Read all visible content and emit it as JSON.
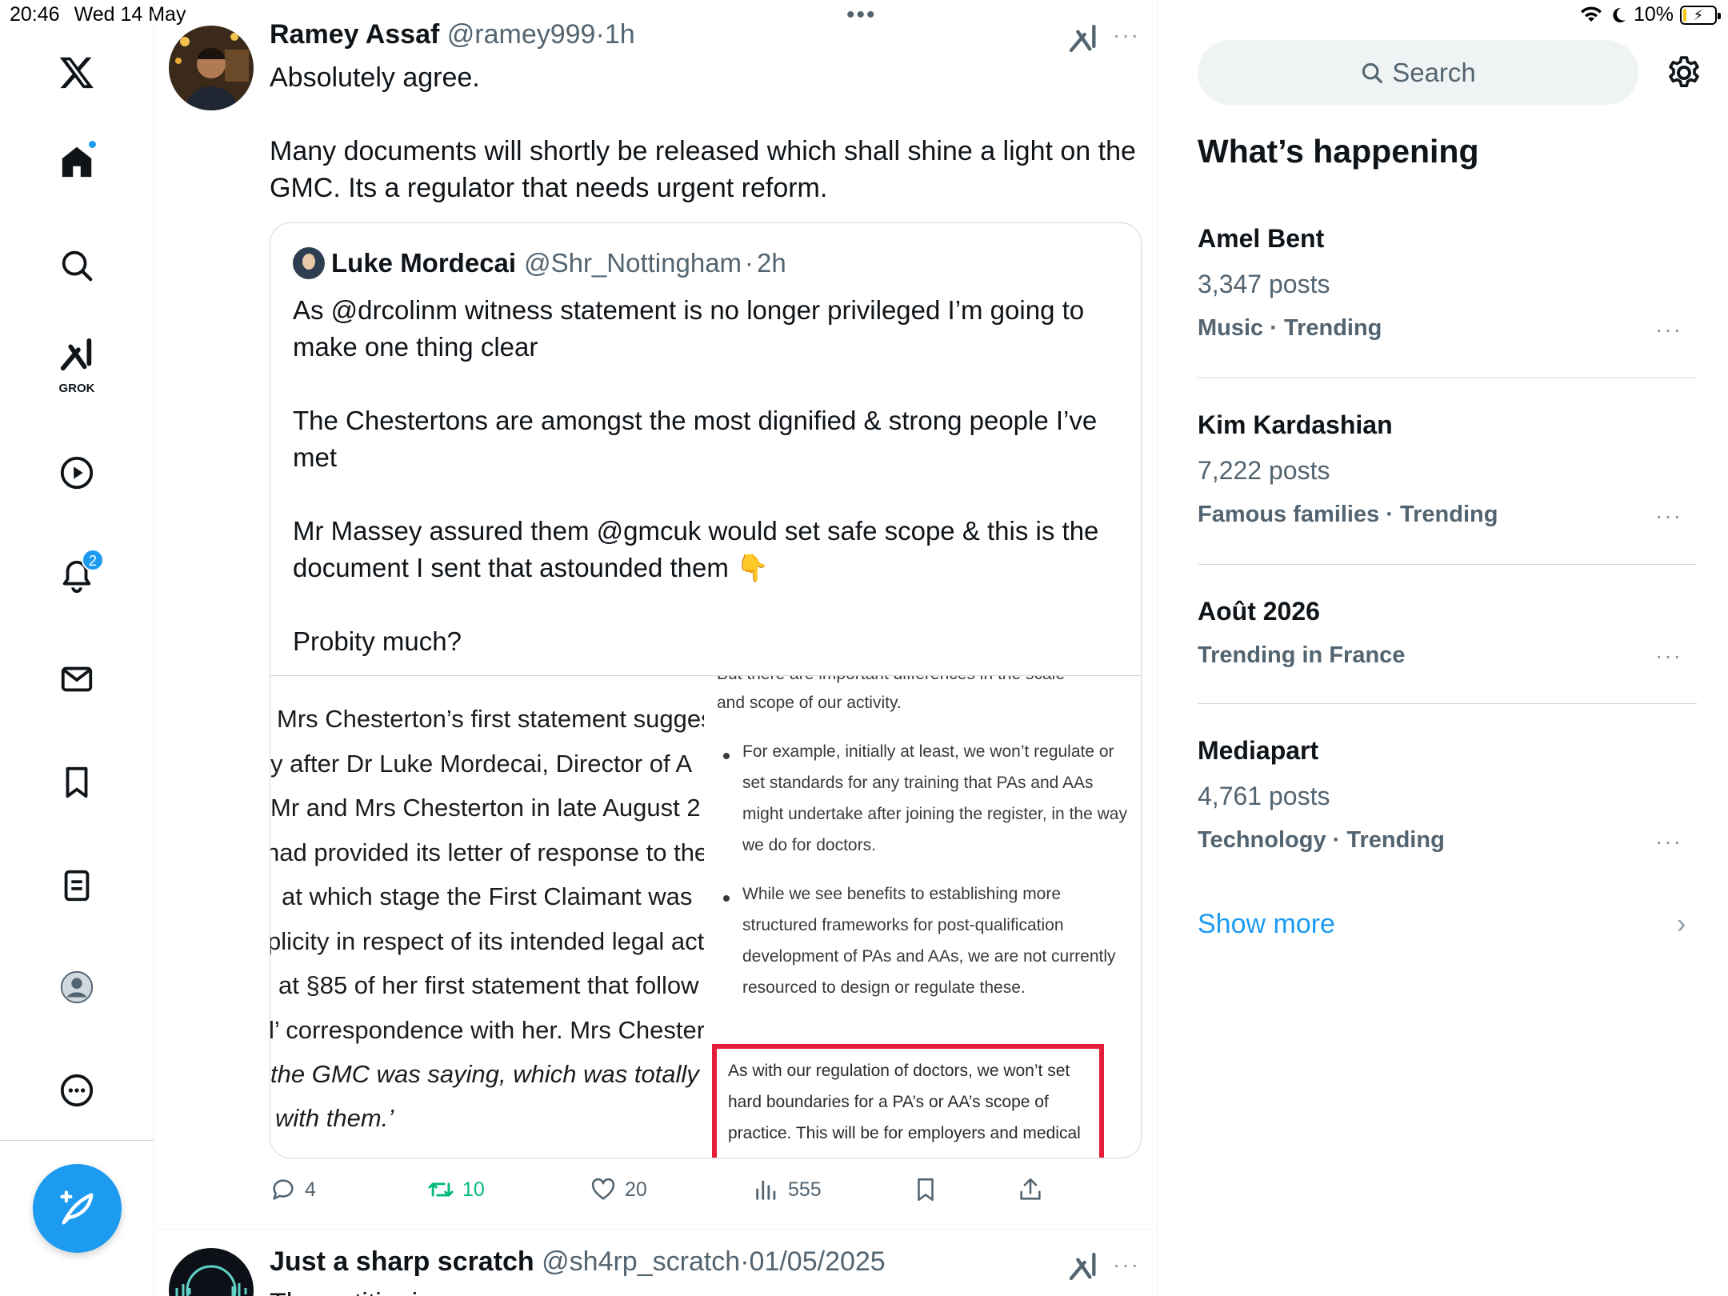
{
  "status_bar": {
    "time": "20:46",
    "date": "Wed 14 May",
    "battery": "10%",
    "battery_fill": 0.1
  },
  "nav": {
    "grok_label": "GROK",
    "notifications_badge": "2"
  },
  "tweet": {
    "name": "Ramey Assaf",
    "handle": "@ramey999",
    "time": "1h",
    "paragraphs": [
      "Absolutely agree.",
      "Many documents will shortly be released which shall shine a light on the GMC. Its a regulator that needs urgent reform."
    ],
    "quote": {
      "name": "Luke Mordecai",
      "handle": "@Shr_Nottingham",
      "time": "2h",
      "paragraphs": [
        "As @drcolinm witness statement is no longer privileged I’m going to make one thing clear",
        "The Chestertons are amongst the most dignified & strong people I’ve met",
        "Mr Massey assured them @gmcuk would set safe scope & this is the document I sent that astounded them 👇",
        "Probity much?"
      ],
      "media": {
        "left_lines": [
          "Mrs Chesterton’s first statement sugges",
          "y after Dr Luke Mordecai, Director of A",
          "Mr and Mrs Chesterton in late August 2",
          "had provided its letter of response to the",
          "at which stage the First Claimant was",
          "plicity in respect of its intended legal acti",
          "at §85 of her first statement that follow",
          "l’ correspondence with her. Mrs Chestert",
          "the GMC was saying, which was totally d",
          "with them.’"
        ],
        "right_top": [
          "But there are important differences in the scale",
          "and scope of our activity."
        ],
        "bullets": [
          "For example, initially at least, we won’t regulate or set standards for any training that PAs and AAs might undertake after joining the register, in the way we do for doctors.",
          "While we see benefits to establishing more structured frameworks for post-qualification development of PAs and AAs, we are not currently resourced to design or regulate these."
        ],
        "highlight": "As with our regulation of doctors, we won’t set hard boundaries for a PA’s or AA’s scope of practice. This will be for employers and medical"
      }
    },
    "actions": {
      "replies": "4",
      "reposts": "10",
      "likes": "20",
      "views": "555"
    }
  },
  "next_tweet": {
    "name": "Just a sharp scratch",
    "handle": "@sh4rp_scratch",
    "date": "01/05/2025",
    "text_start": "The petitioning…"
  },
  "search": {
    "placeholder": "Search"
  },
  "trends": {
    "title": "What’s happening",
    "items": [
      {
        "name": "Amel Bent",
        "posts": "3,347 posts",
        "meta": "Music · Trending"
      },
      {
        "name": "Kim Kardashian",
        "posts": "7,222 posts",
        "meta": "Famous families · Trending"
      },
      {
        "name": "Août 2026",
        "posts": "",
        "meta": "Trending in France"
      },
      {
        "name": "Mediapart",
        "posts": "4,761 posts",
        "meta": "Technology · Trending"
      }
    ],
    "show_more": "Show more"
  },
  "colors": {
    "accent": "#1d9bf0",
    "repost": "#00ba7c",
    "highlight_box": "#e51d3a"
  }
}
